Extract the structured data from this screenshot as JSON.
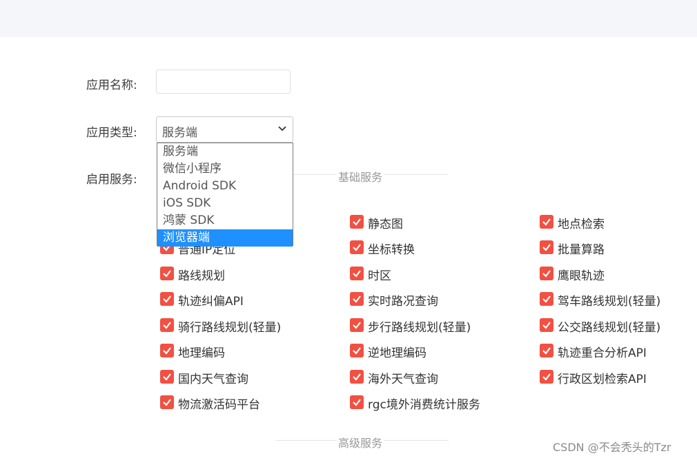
{
  "form": {
    "app_name_label": "应用名称:",
    "app_name_value": "",
    "app_type_label": "应用类型:",
    "app_type_selected": "服务端",
    "app_type_options": [
      "服务端",
      "微信小程序",
      "Android SDK",
      "iOS SDK",
      "鸿蒙 SDK",
      "浏览器端"
    ],
    "app_type_highlighted": "浏览器端",
    "services_label": "启用服务:"
  },
  "sections": {
    "basic_title": "基础服务",
    "advanced_title": "高级服务"
  },
  "services": {
    "col1": [
      "普通IP定位",
      "路线规划",
      "轨迹纠偏API",
      "骑行路线规划(轻量)",
      "地理编码",
      "国内天气查询",
      "物流激活码平台"
    ],
    "col2": [
      "静态图",
      "坐标转换",
      "时区",
      "实时路况查询",
      "步行路线规划(轻量)",
      "逆地理编码",
      "海外天气查询",
      "rgc境外消费统计服务"
    ],
    "col3": [
      "地点检索",
      "批量算路",
      "鹰眼轨迹",
      "驾车路线规划(轻量)",
      "公交路线规划(轻量)",
      "轨迹重合分析API",
      "行政区划检索API"
    ],
    "checked": true,
    "check_color": "#f25042"
  },
  "watermark": "CSDN @不会秃头的Tzr"
}
